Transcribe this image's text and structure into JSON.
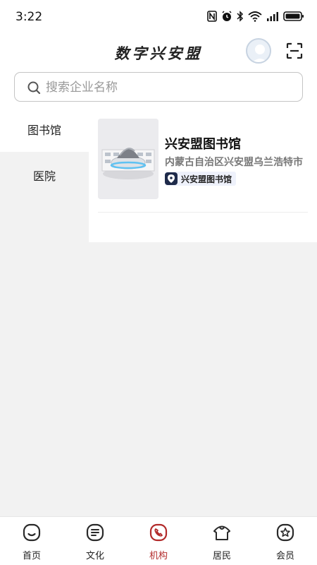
{
  "status_bar": {
    "time": "3:22"
  },
  "header": {
    "app_title": "数字兴安盟"
  },
  "search": {
    "placeholder": "搜索企业名称",
    "value": ""
  },
  "sidebar": {
    "items": [
      {
        "label": "图书馆",
        "active": true
      },
      {
        "label": "医院",
        "active": false
      }
    ]
  },
  "content": {
    "cards": [
      {
        "title": "兴安盟图书馆",
        "address": "内蒙古自治区兴安盟乌兰浩特市",
        "tag": "兴安盟图书馆",
        "tag_icon": "location-pin-icon"
      }
    ]
  },
  "tabbar": {
    "tabs": [
      {
        "label": "首页",
        "icon": "home-icon",
        "active": false
      },
      {
        "label": "文化",
        "icon": "document-icon",
        "active": false
      },
      {
        "label": "机构",
        "icon": "phone-icon",
        "active": true
      },
      {
        "label": "居民",
        "icon": "person-icon",
        "active": false
      },
      {
        "label": "会员",
        "icon": "member-icon",
        "active": false
      }
    ]
  },
  "colors": {
    "accent": "#b22a2a",
    "background": "#f2f2f2",
    "surface": "#ffffff",
    "tag_background": "#eef1fb"
  }
}
